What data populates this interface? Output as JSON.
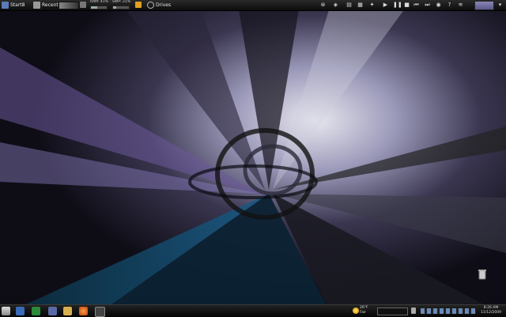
{
  "topbar": {
    "start_label": "Start8",
    "recent_label": "Recent",
    "ram_label": "RAM: 41%",
    "ram_percent": 41,
    "swp_label": "SWP: 21%",
    "swp_percent": 21,
    "drives_label": "Drives",
    "media_buttons": [
      "▶",
      "❚❚",
      "■",
      "⏮",
      "⏭"
    ]
  },
  "desktop": {
    "recycle_bin_label": "Recycle Bin"
  },
  "taskbar": {
    "weather_temp": "26°F",
    "weather_cond": "Fair",
    "clock_time": "8:26 AM",
    "clock_date": "11/12/2009"
  },
  "colors": {
    "accent": "#6a5fa8",
    "highlight": "#2a6fb0"
  }
}
